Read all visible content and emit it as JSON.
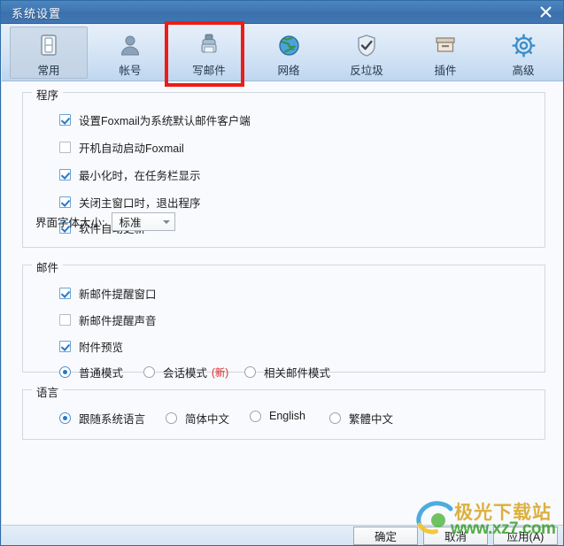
{
  "window": {
    "title": "系统设置",
    "close_icon": "close-icon"
  },
  "toolbar": {
    "tabs": [
      {
        "label": "常用",
        "icon": "toggle-switch-icon",
        "selected": true
      },
      {
        "label": "帐号",
        "icon": "user-icon",
        "selected": false
      },
      {
        "label": "写邮件",
        "icon": "mail-compose-icon",
        "selected": false
      },
      {
        "label": "网络",
        "icon": "globe-icon",
        "selected": false
      },
      {
        "label": "反垃圾",
        "icon": "shield-check-icon",
        "selected": false
      },
      {
        "label": "插件",
        "icon": "plugin-box-icon",
        "selected": false
      },
      {
        "label": "高级",
        "icon": "gear-icon",
        "selected": false
      }
    ],
    "highlight_color": "#ee1c16",
    "highlighted_tab": "写邮件"
  },
  "program_group": {
    "legend": "程序",
    "options": [
      {
        "label": "设置Foxmail为系统默认邮件客户端",
        "checked": true
      },
      {
        "label": "开机自动启动Foxmail",
        "checked": false
      },
      {
        "label": "最小化时，在任务栏显示",
        "checked": true
      },
      {
        "label": "关闭主窗口时，退出程序",
        "checked": true
      },
      {
        "label": "软件自动更新",
        "checked": true
      }
    ],
    "font_size": {
      "label": "界面字体大小:",
      "value": "标准"
    }
  },
  "mail_group": {
    "legend": "邮件",
    "options": [
      {
        "label": "新邮件提醒窗口",
        "checked": true
      },
      {
        "label": "新邮件提醒声音",
        "checked": false
      },
      {
        "label": "附件预览",
        "checked": true
      }
    ],
    "modes": [
      {
        "label": "普通模式",
        "selected": true,
        "badge": ""
      },
      {
        "label": "会话模式",
        "selected": false,
        "badge": "(新)"
      },
      {
        "label": "相关邮件模式",
        "selected": false,
        "badge": ""
      }
    ]
  },
  "language_group": {
    "legend": "语言",
    "options": [
      {
        "label": "跟随系统语言",
        "selected": true
      },
      {
        "label": "简体中文",
        "selected": false
      },
      {
        "label": "English",
        "selected": false
      },
      {
        "label": "繁體中文",
        "selected": false
      }
    ]
  },
  "footer": {
    "ok": "确定",
    "cancel": "取消",
    "apply": "应用(A)"
  },
  "watermark": {
    "title": "极光下载站",
    "url": "www.xz7.com",
    "title_color": "#d8a41f",
    "url_color": "#37a02c"
  }
}
